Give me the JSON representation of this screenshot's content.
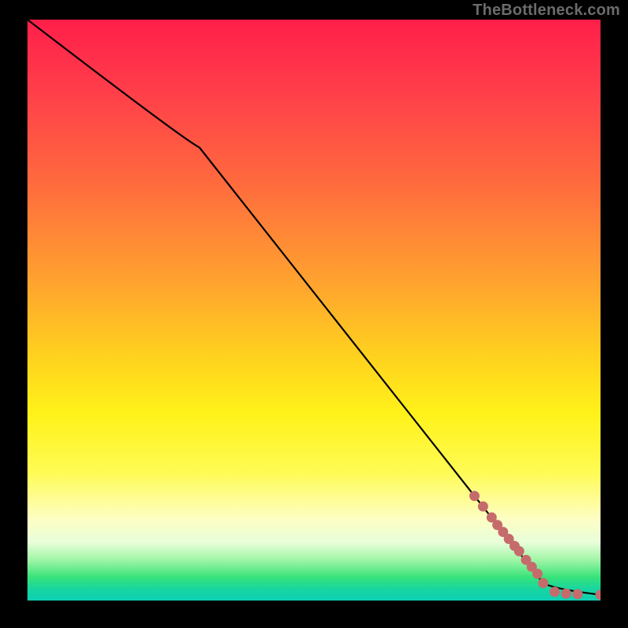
{
  "watermark": "TheBottleneck.com",
  "colors": {
    "line": "#000000",
    "marker": "#c66b6b",
    "frame": "#000000"
  },
  "chart_data": {
    "type": "line",
    "title": "",
    "xlabel": "",
    "ylabel": "",
    "xlim": [
      0,
      100
    ],
    "ylim": [
      0,
      100
    ],
    "grid": false,
    "legend": false,
    "series": [
      {
        "name": "curve",
        "style": "line",
        "x": [
          0,
          30,
          90,
          100
        ],
        "y": [
          100,
          78,
          3,
          1
        ]
      },
      {
        "name": "markers",
        "style": "scatter",
        "x": [
          78,
          79.5,
          81,
          82,
          83,
          84,
          85,
          85.8,
          87,
          88,
          89,
          90,
          92,
          94,
          96,
          100
        ],
        "y": [
          18,
          16.2,
          14.3,
          13,
          11.8,
          10.6,
          9.4,
          8.5,
          7,
          5.8,
          4.6,
          3,
          1.5,
          1.2,
          1.1,
          1
        ]
      }
    ]
  }
}
